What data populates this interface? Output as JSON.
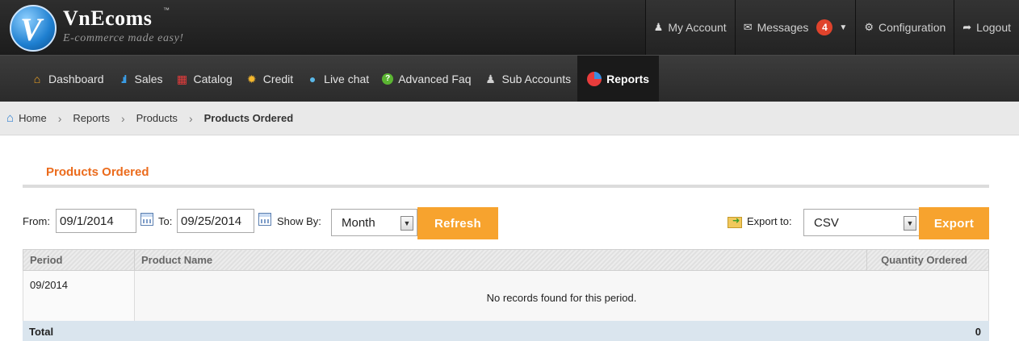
{
  "brand": {
    "name": "VnEcoms",
    "trademark": "™",
    "tagline": "E-commerce made easy!",
    "mark_letter": "V"
  },
  "toplinks": [
    {
      "label": "My Account",
      "icon": "user-icon"
    },
    {
      "label": "Messages",
      "icon": "envelope-icon",
      "badge": "4"
    },
    {
      "label": "Configuration",
      "icon": "gear-icon"
    },
    {
      "label": "Logout",
      "icon": "logout-arrow-icon"
    }
  ],
  "nav": [
    {
      "label": "Dashboard",
      "icon": "home-icon"
    },
    {
      "label": "Sales",
      "icon": "bar-chart-icon"
    },
    {
      "label": "Catalog",
      "icon": "gift-icon"
    },
    {
      "label": "Credit",
      "icon": "sun-coin-icon"
    },
    {
      "label": "Live chat",
      "icon": "chat-bubble-icon"
    },
    {
      "label": "Advanced Faq",
      "icon": "question-icon"
    },
    {
      "label": "Sub Accounts",
      "icon": "user-icon"
    },
    {
      "label": "Reports",
      "icon": "pie-chart-icon",
      "active": true
    }
  ],
  "breadcrumb": [
    "Home",
    "Reports",
    "Products",
    "Products Ordered"
  ],
  "page_title": "Products Ordered",
  "filters": {
    "from_label": "From:",
    "from_value": "09/1/2014",
    "to_label": "To:",
    "to_value": "09/25/2014",
    "show_by_label": "Show By:",
    "show_by_value": "Month",
    "refresh_label": "Refresh",
    "export_label": "Export to:",
    "export_value": "CSV",
    "export_button": "Export"
  },
  "grid": {
    "columns": [
      "Period",
      "Product Name",
      "Quantity Ordered"
    ],
    "rows": [
      {
        "period": "09/2014",
        "message": "No records found for this period."
      }
    ],
    "total_label": "Total",
    "total_value": "0"
  },
  "colors": {
    "accent_orange": "#f7a32e",
    "title_orange": "#eb6b1c",
    "badge_red": "#e0432c",
    "header_dark": "#2e2e2e"
  }
}
